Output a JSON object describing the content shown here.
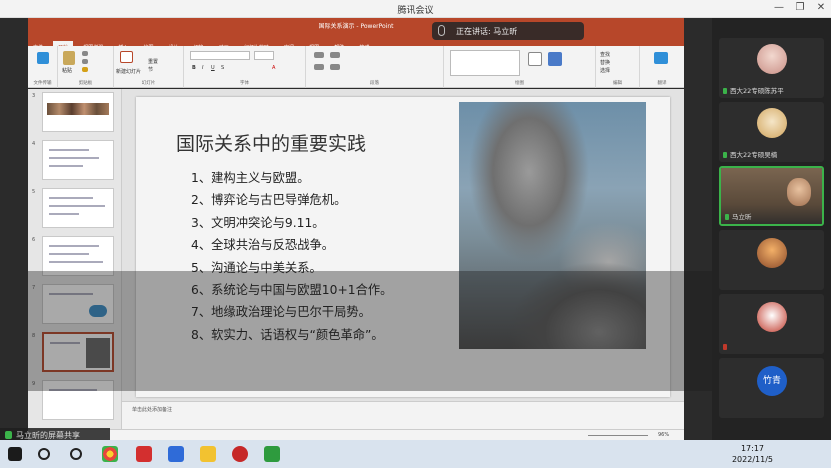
{
  "meeting": {
    "title": "腾讯会议",
    "window_controls": [
      "—",
      "❐",
      "✕"
    ]
  },
  "speaking": {
    "label": "正在讲话: 马立昕"
  },
  "powerpoint": {
    "title": "国际关系演示 - PowerPoint",
    "tabs": [
      "文件",
      "开始",
      "视图增强",
      "插入",
      "绘图",
      "设计",
      "切换",
      "动画",
      "幻灯片放映",
      "审阅",
      "视图",
      "帮助",
      "格式"
    ],
    "active_tab": "开始",
    "groups": [
      "文件传输",
      "剪贴板",
      "幻灯片",
      "字体",
      "段落",
      "绘图",
      "编辑",
      "翻译"
    ],
    "ribbon_buttons": {
      "paste": "粘贴",
      "new_slide": "新建幻灯片",
      "reset": "重置",
      "section": "节",
      "find": "查找",
      "replace": "替换",
      "select": "选择"
    },
    "thumbnail_numbers": [
      "3",
      "4",
      "5",
      "6",
      "7",
      "8",
      "9"
    ],
    "notes_placeholder": "单击此处添加备注",
    "status": {
      "zoom": "96%"
    }
  },
  "slide": {
    "title": "国际关系中的重要实践",
    "items": [
      "1、建构主义与欧盟。",
      "2、博弈论与古巴导弹危机。",
      "3、文明冲突论与9.11。",
      "4、全球共治与反恐战争。",
      "5、沟通论与中美关系。",
      "6、系统论与中国与欧盟10+1合作。",
      "7、地缘政治理论与巴尔干局势。",
      "8、软实力、话语权与“颜色革命”。"
    ]
  },
  "sharer": {
    "label": "马立昕的屏幕共享"
  },
  "participants": [
    {
      "name": "西大22专硕陈苏平",
      "has_video": false
    },
    {
      "name": "西大22专硕吴楠",
      "has_video": false
    },
    {
      "name": "马立昕",
      "has_video": true,
      "speaking": true
    },
    {
      "name": "",
      "has_video": false
    },
    {
      "name": "",
      "has_video": false
    },
    {
      "name": "竹青",
      "has_video": false
    }
  ],
  "taskbar": {
    "time": "17:17",
    "date": "2022/11/5"
  },
  "colors": {
    "ppt_accent": "#b7472a",
    "speaking_green": "#3bb34a"
  }
}
